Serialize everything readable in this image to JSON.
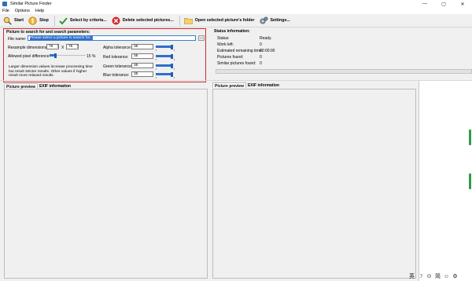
{
  "window": {
    "title": "Similar Picture Finder",
    "minimize": "—",
    "maximize": "▢",
    "close": "✕"
  },
  "menu": [
    "File",
    "Options",
    "Help"
  ],
  "toolbar": {
    "start": "Start",
    "stop": "Stop",
    "select_by_criteria": "Select by criteria...",
    "delete_selected": "Delete selected pictures...",
    "open_folder": "Open selected picture's folder",
    "settings": "Settings..."
  },
  "params": {
    "title": "Picture to search for and search parameters:",
    "file_name_label": "File name:",
    "file_name_value": "Please select a picture to search for...",
    "browse": "...",
    "resample_label": "Resample dimensions:",
    "resample_w": "75",
    "resample_x": "X",
    "resample_h": "75",
    "allowed_pixel_label": "Allowed pixel difference:",
    "allowed_pixel_value": "15 %",
    "allowed_pixel_level": 0.15,
    "hint": "Larger dimension values increase processing time but result stricter results. Other values if higher result more relaxed results.",
    "alpha_label": "Alpha tolerance:",
    "alpha_value": "35",
    "red_label": "Red tolerance:",
    "red_value": "35",
    "green_label": "Green tolerance:",
    "green_value": "35",
    "blue_label": "Blue tolerance:",
    "blue_value": "35"
  },
  "status": {
    "title": "Status information:",
    "rows": [
      {
        "label": "Status:",
        "value": "Ready."
      },
      {
        "label": "Work left:",
        "value": "0"
      },
      {
        "label": "Estimated remaining time:",
        "value": "00:00:00"
      },
      {
        "label": "Pictures found:",
        "value": "0"
      },
      {
        "label": "Similar pictures found:",
        "value": "0"
      }
    ]
  },
  "left_tabs": [
    "Picture preview",
    "EXIF information"
  ],
  "right_tabs": [
    "Picture preview",
    "EXIF information"
  ],
  "tray": [
    "英",
    "☽",
    "⊙",
    "简",
    "☺",
    "⚙"
  ],
  "colors": {
    "accent": "#2f6fca",
    "highlight_border": "#d6282c",
    "green_indicator": "#2e9e45"
  }
}
